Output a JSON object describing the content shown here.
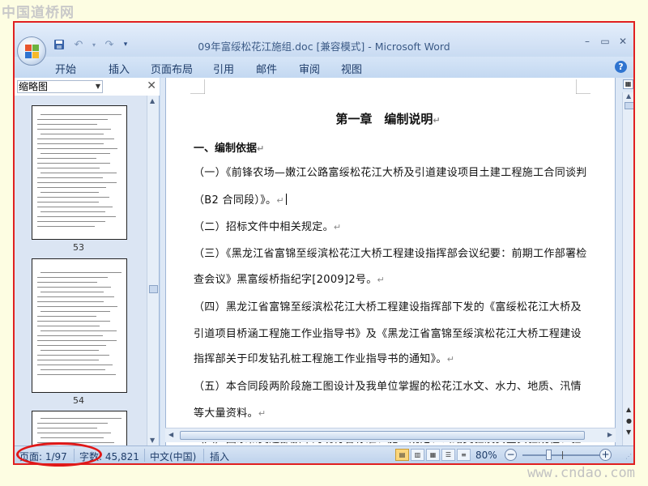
{
  "watermark": {
    "top": "中国道桥网",
    "bottom": "www.cndao.com"
  },
  "window": {
    "title": "09年富绥松花江施组.doc [兼容模式] - Microsoft Word",
    "controls": {
      "minimize": "–",
      "restore": "▭",
      "close": "✕"
    }
  },
  "quick_access": {
    "save": "save-icon",
    "undo": "undo-icon",
    "redo": "redo-icon",
    "customize": "customize-icon"
  },
  "menu": {
    "items": [
      {
        "label": "开始"
      },
      {
        "label": "插入"
      },
      {
        "label": "页面布局"
      },
      {
        "label": "引用"
      },
      {
        "label": "邮件"
      },
      {
        "label": "审阅"
      },
      {
        "label": "视图"
      }
    ]
  },
  "thumbnail_pane": {
    "view_label": "缩略图",
    "page_numbers": [
      "53",
      "54"
    ]
  },
  "document": {
    "chapter_title": "第一章　编制说明",
    "section_heading": "一、编制依据",
    "paragraphs": [
      "（一）《前锋农场—嫩江公路富绥松花江大桥及引道建设项目土建工程施工合同谈判",
      "（B2 合同段）》。",
      "（二）招标文件中相关规定。",
      "（三）《黑龙江省富锦至绥滨松花江大桥工程建设指挥部会议纪要：前期工作部署检",
      "查会议》黑富绥桥指纪字[2009]2号。",
      "（四）黑龙江省富锦至绥滨松花江大桥工程建设指挥部下发的《富绥松花江大桥及",
      "引道项目桥涵工程施工作业指导书》及《黑龙江省富锦至绥滨松花江大桥工程建设",
      "指挥部关于印发钻孔桩工程施工作业指导书的通知》。",
      "（五）本合同段两阶段施工图设计及我单位掌握的松花江水文、水力、地质、汛情",
      "等大量资料。",
      "（六）国家和交通部颁布的现行各标准、施工规范、公路交验及安全实验规程、验"
    ],
    "paragraph_mark": "↵"
  },
  "status_bar": {
    "page": "页面: 1/97",
    "words": "字数: 45,821",
    "language": "中文(中国)",
    "insert_mode": "插入",
    "zoom": "80%",
    "zoom_level": 0.8
  },
  "colors": {
    "frame_border": "#e02020",
    "annotation_circle": "#e01818",
    "ribbon_text": "#1f3d6a"
  }
}
